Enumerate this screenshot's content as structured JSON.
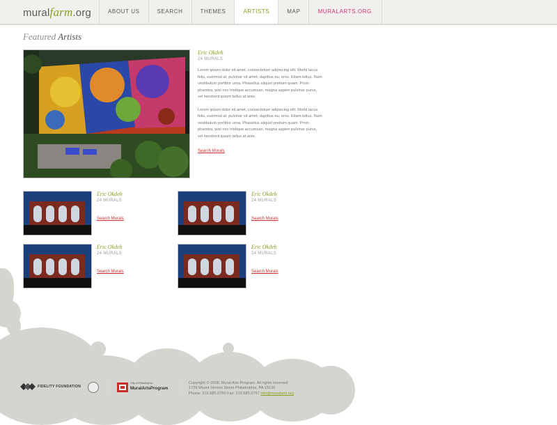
{
  "logo": {
    "part1": "mural",
    "part2": "farm",
    "part3": ".org"
  },
  "nav": [
    {
      "label": "ABOUT US"
    },
    {
      "label": "SEARCH"
    },
    {
      "label": "THEMES"
    },
    {
      "label": "ARTISTS"
    },
    {
      "label": "MAP"
    },
    {
      "label": "MURALARTS.ORG"
    }
  ],
  "page": {
    "title_light": "Featured",
    "title_strong": "Artists"
  },
  "featured": {
    "name": "Eric Okdeh",
    "count": "24 MURALS",
    "para1": "Lorem ipsum dolor sit amet, consectetuer adipiscing elit. Morbi lacus felis, euismod at, pulvinar sit amet, dapibus eu, eros. Etiam tellus. Nam vestibulum porttitor urna. Phasellus aliquet pretium quam. Proin pharetra, wisi nec tristique accumsan, magna sapien pulvinar purus, vel hendrerit ipsum tellus at ante.",
    "para2": "Lorem ipsum dolor sit amet, consectetuer adipiscing elit. Morbi lacus felis, euismod at, pulvinar sit amet, dapibus eu, eros. Etiam tellus. Nam vestibulum porttitor urna. Phasellus aliquet pretium quam. Proin pharetra, wisi nec tristique accumsan, magna sapien pulvinar purus, vel hendrerit ipsum tellus at ante.",
    "link": "Search Murals"
  },
  "artists": [
    {
      "name": "Eric Okdeh",
      "count": "24 MURALS",
      "link": "Search Murals"
    },
    {
      "name": "Eric Okdeh",
      "count": "24 MURALS",
      "link": "Search Murals"
    },
    {
      "name": "Eric Okdeh",
      "count": "24 MURALS",
      "link": "Search Murals"
    },
    {
      "name": "Eric Okdeh",
      "count": "24 MURALS",
      "link": "Search Murals"
    }
  ],
  "footer": {
    "line1": "Copyright © 2008, Mural Arts Program. All rights reserved",
    "line2": "1729 Mount Vernon Street Philadelphia, PA 19130",
    "line3_prefix": "Phone: 215.685.0750   Fax: 215.685.0757",
    "email": "info@muralarts.org",
    "sponsor1": "FIDELITY FOUNDATION",
    "sponsor2_small": "City of Philadelphia",
    "sponsor2": "MuralArtsProgram"
  },
  "colors": {
    "accent_green": "#8aa020",
    "accent_pink": "#d6337a",
    "link_red": "#cc2f2f"
  }
}
